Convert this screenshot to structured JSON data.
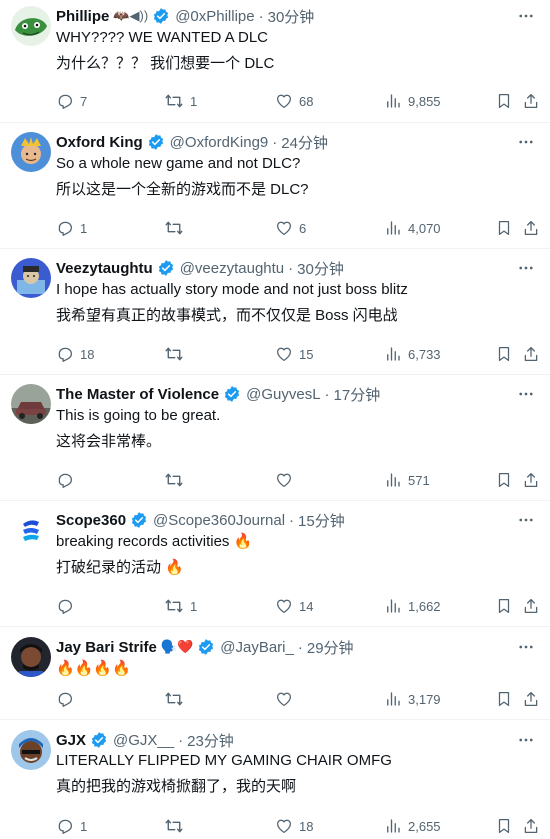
{
  "tweets": [
    {
      "name": "Phillipe",
      "name_emoji": "🦇◀))",
      "verified": true,
      "handle": "@0xPhillipe",
      "time": "30分钟",
      "lines": [
        "WHY???? WE WANTED A DLC",
        "为什么？？？ 我们想要一个 DLC"
      ],
      "replies": "7",
      "retweets": "1",
      "likes": "68",
      "views": "9,855",
      "avatar_color": "#3a8f3f"
    },
    {
      "name": "Oxford King",
      "name_emoji": "",
      "verified": true,
      "handle": "@OxfordKing9",
      "time": "24分钟",
      "lines": [
        "So a whole new game and not DLC?",
        "所以这是一个全新的游戏而不是 DLC?"
      ],
      "replies": "1",
      "retweets": "",
      "likes": "6",
      "views": "4,070",
      "avatar_color": "#2f6fc4"
    },
    {
      "name": "Veezytaughtu",
      "name_emoji": "",
      "verified": true,
      "handle": "@veezytaughtu",
      "time": "30分钟",
      "lines": [
        "I hope has actually story mode and not just boss blitz",
        "我希望有真正的故事模式，而不仅仅是 Boss 闪电战"
      ],
      "replies": "18",
      "retweets": "",
      "likes": "15",
      "views": "6,733",
      "avatar_color": "#3b5bd1"
    },
    {
      "name": "The Master of Violence",
      "name_emoji": "",
      "verified": true,
      "handle": "@GuyvesL",
      "time": "17分钟",
      "lines": [
        "This is going to be great.",
        "这将会非常棒。"
      ],
      "replies": "",
      "retweets": "",
      "likes": "",
      "views": "571",
      "avatar_color": "#6b6f66"
    },
    {
      "name": "Scope360",
      "name_emoji": "",
      "verified": true,
      "handle": "@Scope360Journal",
      "time": "15分钟",
      "lines": [
        "breaking records activities 🔥",
        "打破纪录的活动  🔥"
      ],
      "replies": "",
      "retweets": "1",
      "likes": "14",
      "views": "1,662",
      "avatar_color": "#1d4ed8"
    },
    {
      "name": "Jay Bari Strife",
      "name_emoji": "🗣️❤️",
      "verified": true,
      "handle": "@JayBari_",
      "time": "29分钟",
      "lines": [
        "🔥🔥🔥🔥"
      ],
      "replies": "",
      "retweets": "",
      "likes": "",
      "views": "3,179",
      "avatar_color": "#2b2b33"
    },
    {
      "name": "GJX",
      "name_emoji": "",
      "verified": true,
      "handle": "@GJX__",
      "time": "23分钟",
      "lines": [
        "LITERALLY FLIPPED MY GAMING CHAIR OMFG",
        "真的把我的游戏椅掀翻了，我的天啊"
      ],
      "replies": "1",
      "retweets": "",
      "likes": "18",
      "views": "2,655",
      "avatar_color": "#1e64b4"
    }
  ],
  "icons": {
    "verified": "verified-badge-icon",
    "more": "more-options-icon",
    "reply": "reply-icon",
    "retweet": "retweet-icon",
    "like": "like-icon",
    "views": "views-icon",
    "bookmark": "bookmark-icon",
    "share": "share-icon"
  },
  "colors": {
    "verified": "#1d9bf0",
    "muted": "#536471",
    "text": "#0f1419",
    "divider": "#eff3f4"
  }
}
